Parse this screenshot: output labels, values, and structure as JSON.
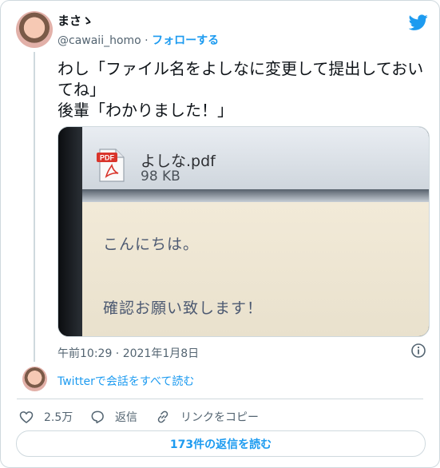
{
  "user": {
    "name": "まさ",
    "name_suffix": "ゝ",
    "handle": "@cawaii_homo",
    "separator": " · ",
    "follow_label": "フォローする"
  },
  "tweet": {
    "lines": [
      "わし「ファイル名をよしなに変更して提出しておい",
      "てね」",
      "後輩「わかりました！」"
    ],
    "timestamp": "午前10:29 · 2021年1月8日"
  },
  "photo": {
    "pdf_badge": "PDF",
    "file_name": "よしな.pdf",
    "file_size": "98 KB",
    "mail_line1": "こんにちは。",
    "mail_line2": "確認お願い致します！"
  },
  "conversation": {
    "read_all": "Twitterで会話をすべて読む"
  },
  "actions": {
    "like_count": "2.5万",
    "reply_label": "返信",
    "copy_link_label": "リンクをコピー"
  },
  "replies_button": "173件の返信を読む",
  "colors": {
    "accent": "#1d9bf0",
    "secondary_text": "#536471",
    "border": "#cfd9de"
  },
  "icons": [
    "twitter-bird-icon",
    "info-icon",
    "heart-icon",
    "reply-icon",
    "link-icon",
    "pdf-icon"
  ]
}
